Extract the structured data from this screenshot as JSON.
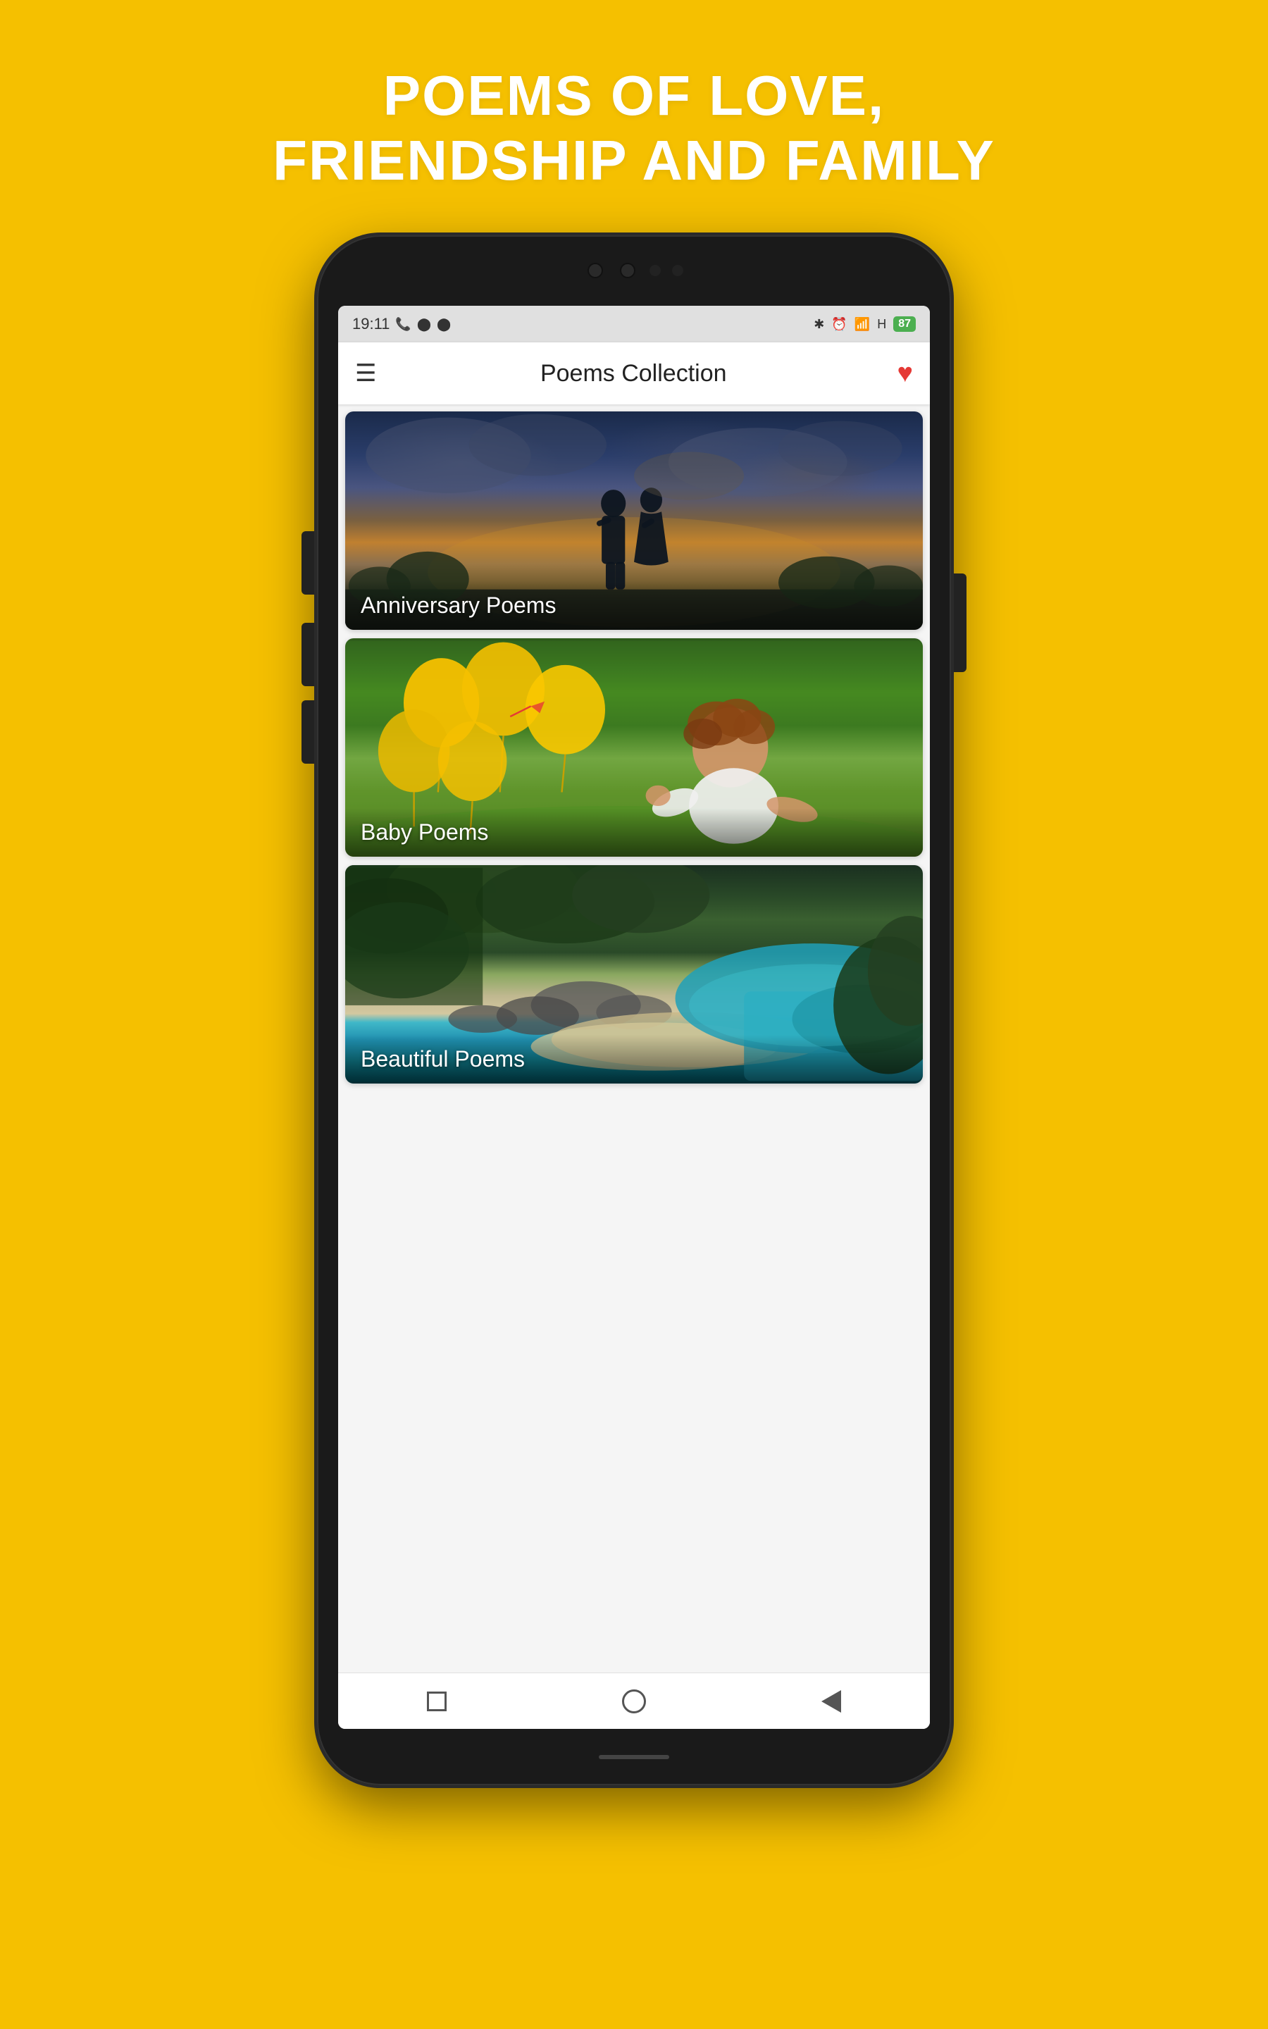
{
  "page": {
    "background_color": "#F5C000",
    "title_line1": "POEMS OF LOVE,",
    "title_line2": "FRIENDSHIP AND FAMILY"
  },
  "status_bar": {
    "time": "19:11",
    "battery_level": "87",
    "icons": [
      "bluetooth",
      "alarm",
      "signal",
      "H"
    ]
  },
  "app_bar": {
    "title": "Poems Collection",
    "menu_icon": "☰",
    "favorite_icon": "♥"
  },
  "categories": [
    {
      "id": "anniversary",
      "label": "Anniversary Poems",
      "theme": "anniversary"
    },
    {
      "id": "baby",
      "label": "Baby Poems",
      "theme": "baby"
    },
    {
      "id": "beautiful",
      "label": "Beautiful Poems",
      "theme": "beautiful"
    }
  ],
  "bottom_nav": {
    "buttons": [
      "square",
      "circle",
      "back"
    ]
  }
}
